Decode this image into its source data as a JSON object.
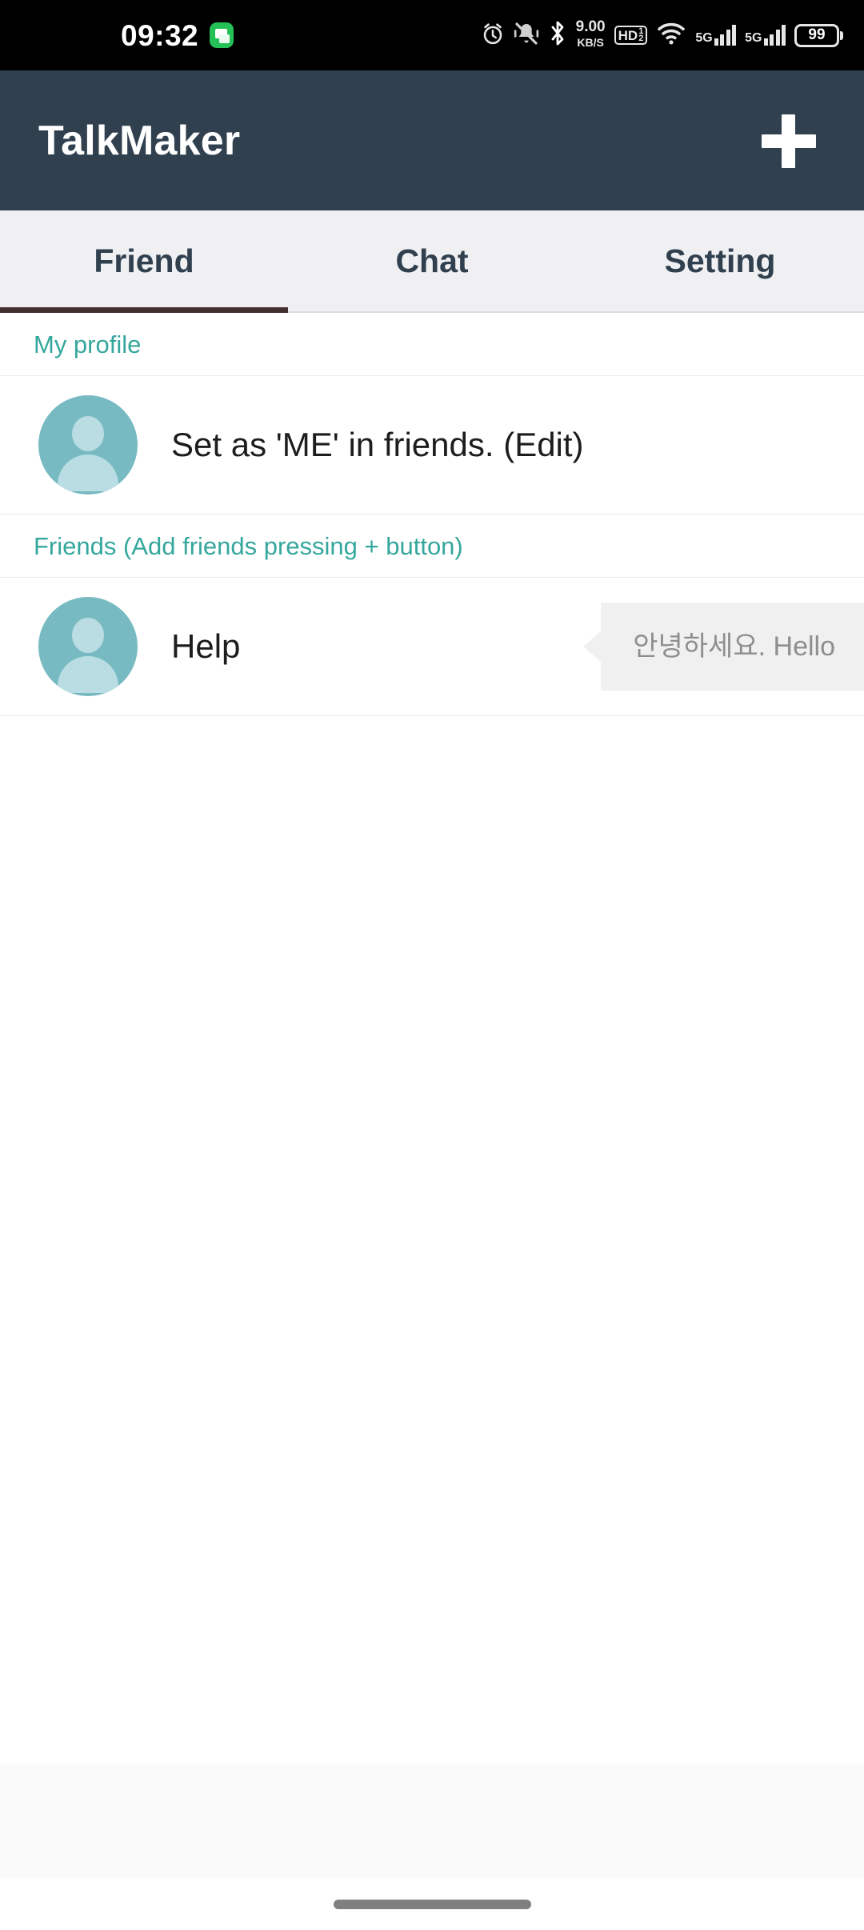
{
  "status_bar": {
    "time": "09:32",
    "app_notification_icon": "messaging-app-icon",
    "alarm_icon": "alarm-clock-icon",
    "silent_icon": "bell-muted-icon",
    "bluetooth_icon": "bluetooth-icon",
    "network_speed_value": "9.00",
    "network_speed_unit": "KB/S",
    "hd_label": "HD",
    "hd_sup": "1",
    "hd_sub": "2",
    "wifi_icon": "wifi-icon",
    "sim1_network": "5G",
    "sim2_network": "5G",
    "battery_level": "99"
  },
  "app_bar": {
    "title": "TalkMaker",
    "add_button_label": "+",
    "background_color": "#30404f"
  },
  "tabs": {
    "active_index": 0,
    "indicator_color": "#42302e",
    "items": [
      {
        "label": "Friend"
      },
      {
        "label": "Chat"
      },
      {
        "label": "Setting"
      }
    ]
  },
  "sections": [
    {
      "header": "My profile",
      "rows": [
        {
          "avatar": "default-person-avatar",
          "name": "Set as 'ME' in friends. (Edit)",
          "status_message": null
        }
      ]
    },
    {
      "header": "Friends (Add friends pressing + button)",
      "rows": [
        {
          "avatar": "default-person-avatar",
          "name": "Help",
          "status_message": "안녕하세요. Hello"
        }
      ]
    }
  ],
  "colors": {
    "accent_teal": "#35a79c",
    "avatar_teal": "#78bac2",
    "bubble_bg": "#f0f0f0",
    "bubble_text": "#8e8e8e"
  },
  "navigation_bar": {
    "gesture_handle": "home-gesture-bar"
  }
}
